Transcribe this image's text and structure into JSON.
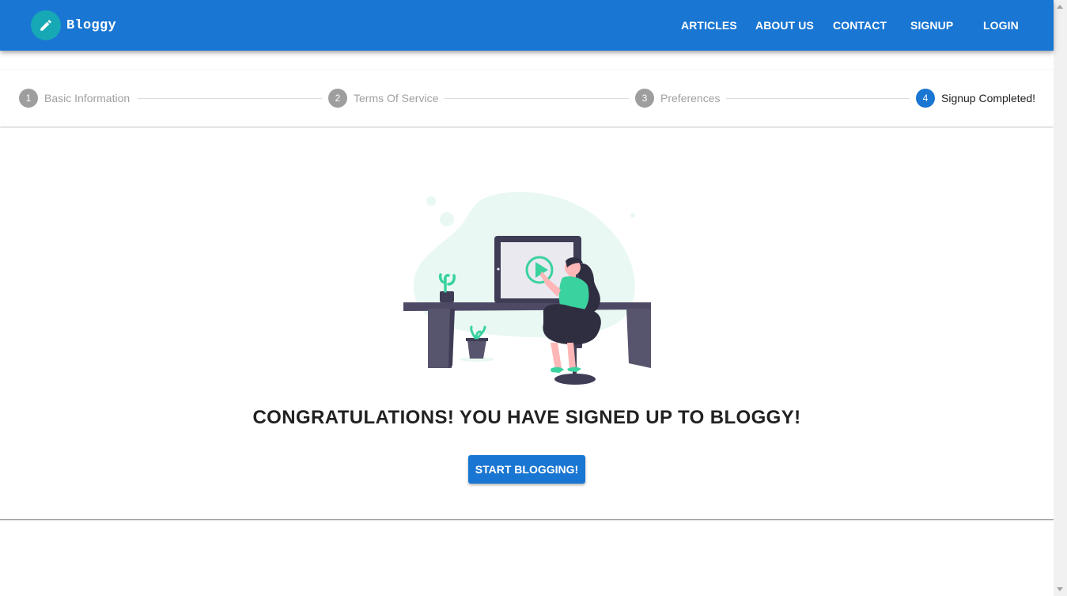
{
  "brand": {
    "name": "Bloggy",
    "logo_icon": "pencil-icon"
  },
  "nav": [
    {
      "label": "ARTICLES"
    },
    {
      "label": "ABOUT US"
    },
    {
      "label": "CONTACT"
    },
    {
      "label": "SIGNUP"
    },
    {
      "label": "LOGIN"
    }
  ],
  "stepper": {
    "steps": [
      {
        "number": "1",
        "label": "Basic Information",
        "active": false
      },
      {
        "number": "2",
        "label": "Terms Of Service",
        "active": false
      },
      {
        "number": "3",
        "label": "Preferences",
        "active": false
      },
      {
        "number": "4",
        "label": "Signup Completed!",
        "active": true
      }
    ]
  },
  "main": {
    "message": "CONGRATULATIONS! YOU HAVE SIGNED UP TO BLOGGY!",
    "cta_label": "START BLOGGING!"
  },
  "colors": {
    "primary": "#1976d2",
    "logo_bg": "#16a8b5",
    "accent_green": "#3ad29f",
    "inactive_step": "#9e9e9e"
  }
}
